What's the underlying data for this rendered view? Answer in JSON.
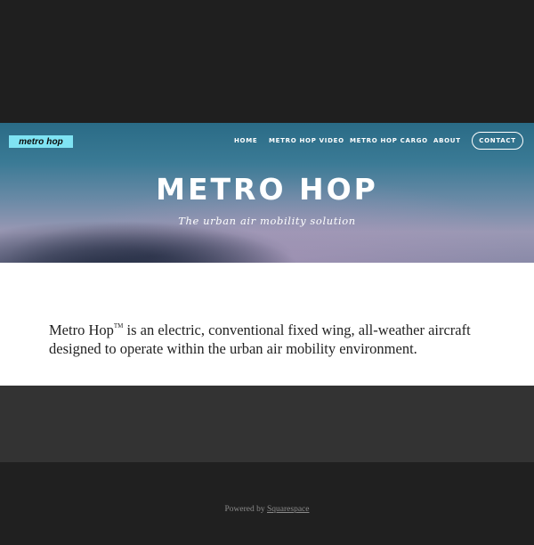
{
  "brand": {
    "logo_text": "metro hop",
    "logo_color": "#7fe3f3"
  },
  "nav": {
    "items": [
      {
        "label": "HOME"
      },
      {
        "label": "METRO HOP VIDEO"
      },
      {
        "label": "METRO HOP CARGO"
      },
      {
        "label": "ABOUT"
      }
    ],
    "contact_label": "CONTACT"
  },
  "hero": {
    "title": "METRO HOP",
    "subtitle": "The urban air mobility solution"
  },
  "intro": {
    "name": "Metro Hop",
    "trademark": "TM",
    "text": " is an electric, conventional fixed wing, all-weather aircraft designed to operate within the urban air mobility environment."
  },
  "footer": {
    "prefix": "Powered by ",
    "link_label": "Squarespace"
  }
}
